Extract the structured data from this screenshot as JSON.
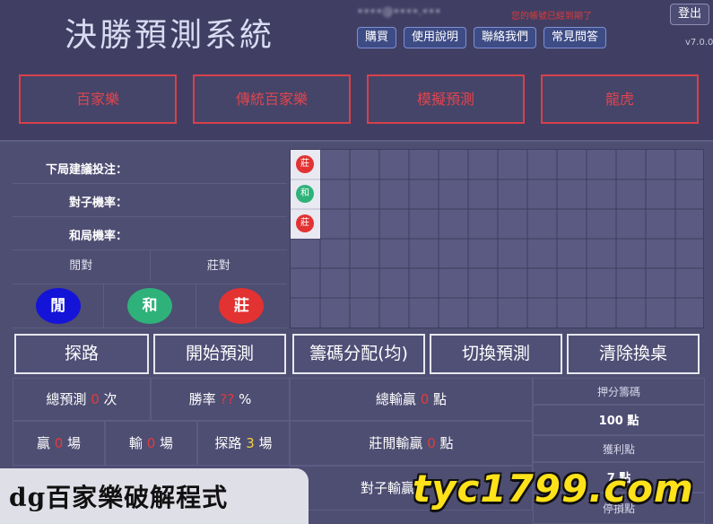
{
  "header": {
    "title": "決勝預測系統",
    "user_email": "••••@••••.•••",
    "expiry_notice": "您的帳號已經到期了",
    "logout_label": "登出",
    "version": "v7.0.0",
    "top_buttons": [
      "購買",
      "使用說明",
      "聯絡我們",
      "常見問答"
    ]
  },
  "modes": [
    "百家樂",
    "傳統百家樂",
    "模擬預測",
    "龍虎"
  ],
  "left_panel": {
    "next_bet_label": "下局建議投注：",
    "pair_rate_label": "對子機率：",
    "tie_rate_label": "和局機率：",
    "player_pair_label": "閒對",
    "banker_pair_label": "莊對",
    "player_label": "閒",
    "tie_label": "和",
    "banker_label": "莊"
  },
  "road": {
    "beads": [
      "莊",
      "和",
      "莊"
    ]
  },
  "actions": [
    "探路",
    "開始預測",
    "籌碼分配(均)",
    "切換預測",
    "清除換桌"
  ],
  "stats": {
    "total_pred_prefix": "總預測",
    "total_pred_value": "0",
    "total_pred_suffix": "次",
    "win_rate_prefix": "勝率",
    "win_rate_value": "??",
    "win_rate_suffix": "%",
    "total_net_prefix": "總輸贏",
    "total_net_value": "0",
    "total_net_suffix": "點",
    "win_prefix": "贏",
    "win_value": "0",
    "win_suffix": "場",
    "lose_prefix": "輸",
    "lose_value": "0",
    "lose_suffix": "場",
    "probe_prefix": "探路",
    "probe_value": "3",
    "probe_suffix": "場",
    "bp_net_prefix": "莊閒輸贏",
    "bp_net_value": "0",
    "bp_net_suffix": "點",
    "pair_net_prefix": "對子輸贏",
    "bet_chips_label": "押分籌碼",
    "bet_chips_value": "100 點",
    "profit_label": "獲利點",
    "profit_value": "7 點",
    "loss_label": "停損點"
  },
  "watermark": {
    "text": "dg百家樂破解程式",
    "url": "tyc1799.com"
  },
  "colors": {
    "player": "#1414d8",
    "tie": "#2fb27a",
    "banker": "#e23232",
    "mode_border": "#d8404a"
  }
}
